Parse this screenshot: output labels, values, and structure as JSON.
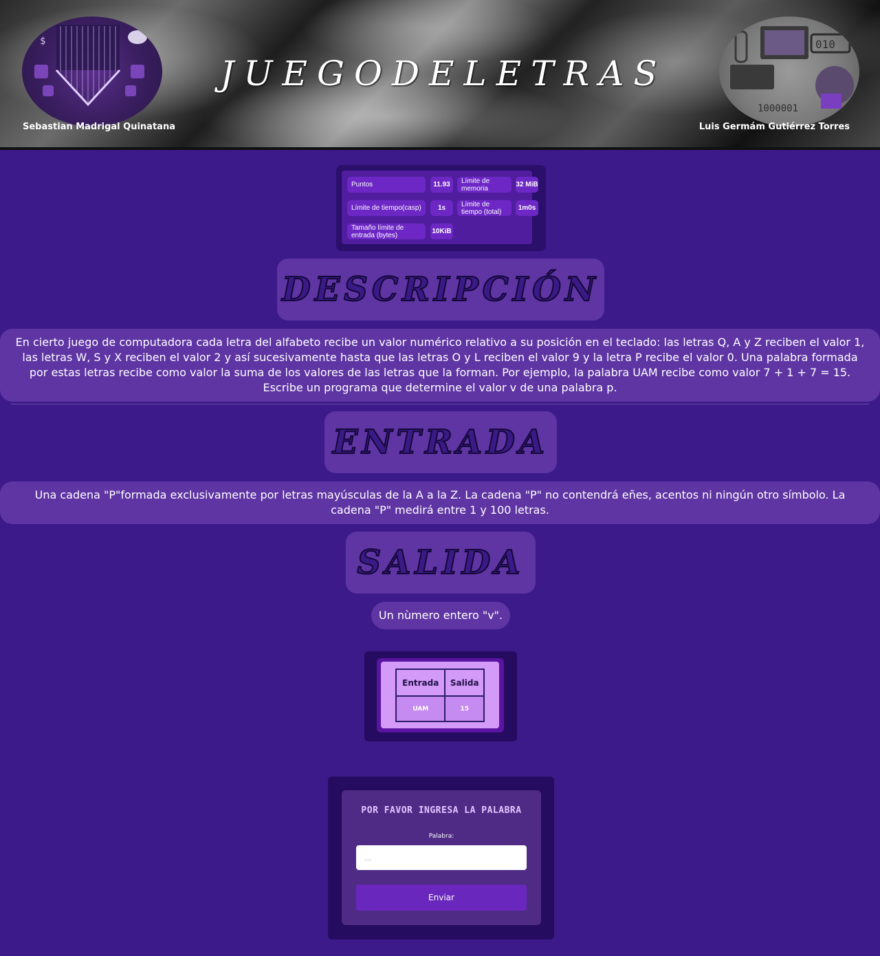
{
  "header": {
    "title": "JUEGODELETRAS",
    "author_left": "Sebastian Madrigal Quinatana",
    "author_right": "Luis Germám Gutiérrez Torres"
  },
  "limits": {
    "points_label": "Puntos",
    "points_value": "11.93",
    "memory_label": "Límite de memoria",
    "memory_value": "32 MiB",
    "time_case_label": "Límite de tiempo(casp)",
    "time_case_value": "1s",
    "time_total_label": "Límite de tiempo (total)",
    "time_total_value": "1m0s",
    "input_size_label": "Tamaño límite de entrada (bytes)",
    "input_size_value": "10KiB"
  },
  "sections": {
    "description_title": "DESCRIPCIÓN",
    "description_text": "En cierto juego de computadora cada letra del alfabeto recibe un valor numérico relativo a su posición en el teclado: las letras Q, A y Z reciben el valor 1, las letras W, S y X reciben el valor 2 y así sucesivamente hasta que las letras O y L reciben el valor 9 y la letra P recibe el valor 0. Una palabra formada por estas letras recibe como valor la suma de los valores de las letras que la forman. Por ejemplo, la palabra UAM recibe como valor 7 + 1 + 7 = 15. Escribe un programa que determine el valor v de una palabra p.",
    "input_title": "ENTRADA",
    "input_text": "Una cadena \"P\"formada exclusivamente por letras mayúsculas de la A a la Z. La cadena \"P\" no contendrá eñes, acentos ni ningún otro símbolo. La cadena \"P\" medirá entre 1 y 100 letras.",
    "output_title": "SALIDA",
    "output_text": "Un nùmero entero \"v\"."
  },
  "example": {
    "header_input": "Entrada",
    "header_output": "Salida",
    "row_input": "UAM",
    "row_output": "15"
  },
  "form": {
    "title": "POR FAVOR INGRESA LA PALABRA",
    "label": "Palabra:",
    "placeholder": "...",
    "submit_label": "Enviar"
  },
  "colors": {
    "background": "#3c1a89",
    "panel": "#5f35a4",
    "heading_text": "#3a1a86",
    "button": "#6a27be"
  }
}
